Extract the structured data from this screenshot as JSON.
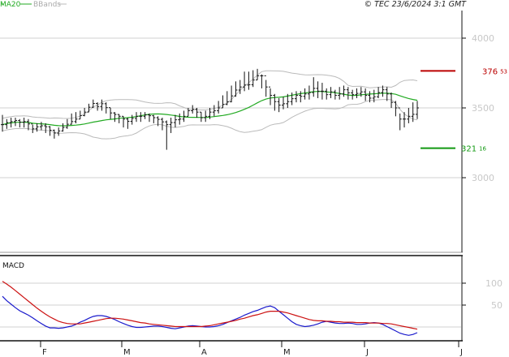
{
  "header": {
    "legend_ma": "MA20",
    "legend_bb": "BBands",
    "credit": "© TEC 23/6/2024 3:1 GMT"
  },
  "colors": {
    "price_bars": "#111111",
    "ma20": "#22aa22",
    "bbands": "#bbbbbb",
    "grid": "#d0d0d0",
    "macd": "#1a1acc",
    "signal": "#cc1111",
    "resistance": "#bb0000",
    "support": "#119911"
  },
  "chart_data": [
    {
      "type": "ohlc",
      "panel": "price",
      "ylim": [
        2800,
        4300
      ],
      "y_ticks": [
        3000,
        3500,
        4000
      ],
      "y_tick_labels": [
        "3000",
        "3500",
        "4000"
      ],
      "x_tick_labels": [
        "F",
        "M",
        "A",
        "M",
        "J",
        "J"
      ],
      "x_ticks_month": [
        1,
        2,
        3,
        4,
        5,
        6
      ],
      "levels": [
        {
          "kind": "resistance",
          "main": "376",
          "dec": "53",
          "value": 3765.3
        },
        {
          "kind": "support",
          "main": "321",
          "dec": "16",
          "value": 3211.6
        }
      ],
      "close": [
        3380,
        3395,
        3402,
        3410,
        3398,
        3402,
        3385,
        3350,
        3365,
        3372,
        3365,
        3340,
        3320,
        3335,
        3360,
        3383,
        3402,
        3420,
        3445,
        3470,
        3505,
        3532,
        3510,
        3530,
        3502,
        3464,
        3453,
        3440,
        3420,
        3404,
        3425,
        3440,
        3440,
        3450,
        3444,
        3430,
        3418,
        3400,
        3380,
        3395,
        3415,
        3420,
        3440,
        3480,
        3490,
        3470,
        3430,
        3440,
        3470,
        3480,
        3500,
        3525,
        3544,
        3586,
        3628,
        3650,
        3664,
        3666,
        3700,
        3730,
        3730,
        3650,
        3590,
        3545,
        3520,
        3530,
        3545,
        3566,
        3590,
        3583,
        3600,
        3610,
        3640,
        3620,
        3620,
        3595,
        3615,
        3590,
        3600,
        3630,
        3608,
        3595,
        3604,
        3615,
        3590,
        3570,
        3580,
        3610,
        3630,
        3600,
        3540,
        3500,
        3420,
        3420,
        3440,
        3454,
        3500
      ],
      "high": [
        3450,
        3420,
        3430,
        3430,
        3420,
        3430,
        3420,
        3380,
        3390,
        3400,
        3390,
        3370,
        3345,
        3360,
        3390,
        3420,
        3460,
        3470,
        3480,
        3500,
        3530,
        3560,
        3540,
        3560,
        3540,
        3500,
        3470,
        3455,
        3440,
        3430,
        3450,
        3470,
        3470,
        3470,
        3460,
        3450,
        3440,
        3430,
        3410,
        3430,
        3450,
        3460,
        3480,
        3500,
        3520,
        3500,
        3470,
        3480,
        3500,
        3520,
        3550,
        3590,
        3620,
        3660,
        3690,
        3700,
        3760,
        3760,
        3770,
        3780,
        3740,
        3700,
        3640,
        3600,
        3570,
        3580,
        3600,
        3610,
        3620,
        3620,
        3640,
        3660,
        3720,
        3690,
        3680,
        3640,
        3650,
        3630,
        3650,
        3660,
        3650,
        3630,
        3640,
        3650,
        3640,
        3620,
        3630,
        3650,
        3660,
        3650,
        3610,
        3550,
        3460,
        3470,
        3500,
        3540,
        3550
      ],
      "low": [
        3330,
        3350,
        3360,
        3370,
        3360,
        3360,
        3340,
        3320,
        3330,
        3340,
        3320,
        3300,
        3280,
        3300,
        3330,
        3350,
        3380,
        3390,
        3420,
        3440,
        3470,
        3500,
        3480,
        3480,
        3460,
        3420,
        3400,
        3390,
        3360,
        3350,
        3380,
        3400,
        3400,
        3420,
        3400,
        3390,
        3370,
        3340,
        3200,
        3320,
        3360,
        3380,
        3400,
        3440,
        3460,
        3430,
        3400,
        3400,
        3420,
        3440,
        3460,
        3500,
        3520,
        3540,
        3580,
        3600,
        3620,
        3630,
        3650,
        3700,
        3640,
        3580,
        3520,
        3480,
        3470,
        3490,
        3500,
        3520,
        3540,
        3540,
        3560,
        3560,
        3580,
        3570,
        3560,
        3560,
        3570,
        3560,
        3560,
        3580,
        3560,
        3560,
        3570,
        3580,
        3550,
        3540,
        3540,
        3570,
        3580,
        3550,
        3500,
        3440,
        3340,
        3360,
        3390,
        3400,
        3420
      ]
    },
    {
      "type": "line",
      "panel": "macd",
      "title": "MACD",
      "y_ticks": [
        50,
        100
      ],
      "y_tick_labels": [
        "50",
        "100"
      ],
      "ylim": [
        -25,
        135
      ],
      "series": [
        {
          "key": "macd",
          "values": [
            70,
            60,
            52,
            44,
            37,
            32,
            27,
            21,
            14,
            8,
            2,
            -2,
            -2,
            -3,
            -2,
            0,
            2,
            6,
            11,
            15,
            20,
            24,
            26,
            26,
            24,
            21,
            17,
            12,
            8,
            4,
            1,
            -1,
            -1,
            0,
            1,
            2,
            2,
            1,
            -1,
            -3,
            -4,
            -2,
            0,
            2,
            3,
            2,
            1,
            0,
            0,
            1,
            3,
            6,
            10,
            14,
            18,
            22,
            27,
            31,
            35,
            38,
            42,
            46,
            48,
            44,
            36,
            28,
            20,
            12,
            6,
            3,
            1,
            2,
            4,
            7,
            11,
            13,
            11,
            9,
            8,
            8,
            9,
            8,
            6,
            6,
            7,
            9,
            10,
            9,
            6,
            1,
            -4,
            -9,
            -14,
            -17,
            -19,
            -17,
            -13
          ]
        },
        {
          "key": "signal",
          "values": [
            104,
            98,
            91,
            83,
            75,
            67,
            59,
            51,
            43,
            36,
            29,
            23,
            18,
            13,
            10,
            8,
            7,
            7,
            7,
            9,
            11,
            13,
            15,
            17,
            19,
            20,
            20,
            19,
            18,
            16,
            14,
            12,
            10,
            9,
            7,
            6,
            5,
            4,
            3,
            2,
            1,
            1,
            1,
            1,
            1,
            1,
            1,
            2,
            3,
            5,
            7,
            9,
            11,
            13,
            15,
            18,
            20,
            23,
            26,
            28,
            31,
            34,
            36,
            36,
            36,
            34,
            32,
            29,
            26,
            23,
            20,
            17,
            15,
            14,
            14,
            13,
            13,
            12,
            12,
            11,
            11,
            11,
            10,
            10,
            10,
            9,
            9,
            9,
            8,
            8,
            7,
            5,
            3,
            1,
            -1,
            -3,
            -5
          ]
        }
      ]
    }
  ]
}
